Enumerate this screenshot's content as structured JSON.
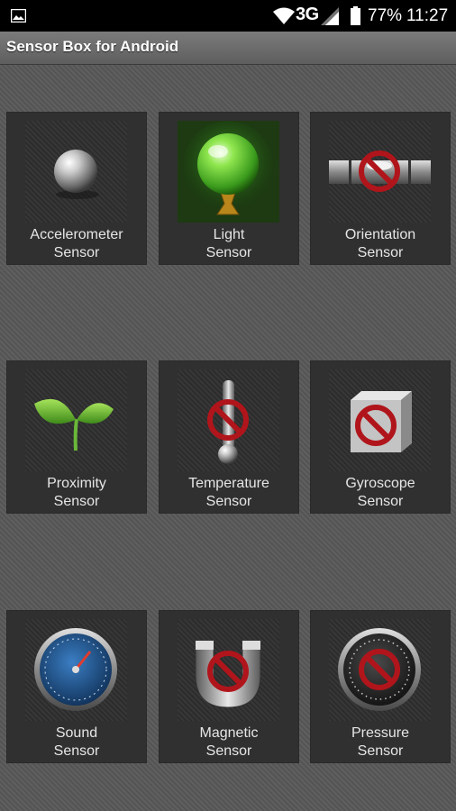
{
  "status_bar": {
    "network": "3G",
    "battery_percent": "77%",
    "time": "11:27",
    "icons": [
      "image-icon",
      "wifi-icon",
      "cell-signal-icon",
      "battery-icon"
    ]
  },
  "app_bar": {
    "title": "Sensor Box for Android"
  },
  "sensors": [
    {
      "line1": "Accelerometer",
      "line2": "Sensor",
      "icon": "metal-ball-icon",
      "available": true
    },
    {
      "line1": "Light",
      "line2": "Sensor",
      "icon": "green-crystal-ball-icon",
      "available": true
    },
    {
      "line1": "Orientation",
      "line2": "Sensor",
      "icon": "spirit-level-icon",
      "available": false
    },
    {
      "line1": "Proximity",
      "line2": "Sensor",
      "icon": "sprout-icon",
      "available": true
    },
    {
      "line1": "Temperature",
      "line2": "Sensor",
      "icon": "thermometer-icon",
      "available": false
    },
    {
      "line1": "Gyroscope",
      "line2": "Sensor",
      "icon": "cube-icon",
      "available": false
    },
    {
      "line1": "Sound",
      "line2": "Sensor",
      "icon": "sound-gauge-icon",
      "available": true
    },
    {
      "line1": "Magnetic",
      "line2": "Sensor",
      "icon": "magnet-icon",
      "available": false
    },
    {
      "line1": "Pressure",
      "line2": "Sensor",
      "icon": "pressure-gauge-icon",
      "available": false
    }
  ],
  "colors": {
    "unavailable_mark": "#b0151b",
    "light_green": "#6fd23a",
    "sound_dial_blue": "#1c4f86"
  }
}
